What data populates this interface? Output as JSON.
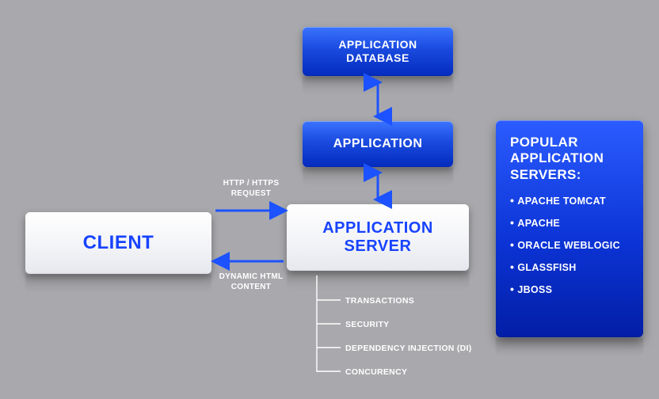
{
  "nodes": {
    "client": "CLIENT",
    "app_server": "APPLICATION SERVER",
    "application": "APPLICATION",
    "app_db": "APPLICATION DATABASE"
  },
  "arrows": {
    "request_label": "HTTP / HTTPS REQUEST",
    "response_label": "DYNAMIC HTML CONTENT"
  },
  "features": {
    "f1": "TRANSACTIONS",
    "f2": "SECURITY",
    "f3": "DEPENDENCY INJECTION (DI)",
    "f4": "CONCURENCY"
  },
  "panel": {
    "title": "POPULAR APPLICATION SERVERS:",
    "items": {
      "i0": "APACHE TOMCAT",
      "i1": "APACHE",
      "i2": "ORACLE WEBLOGIC",
      "i3": "GLASSFISH",
      "i4": "JBOSS"
    }
  }
}
